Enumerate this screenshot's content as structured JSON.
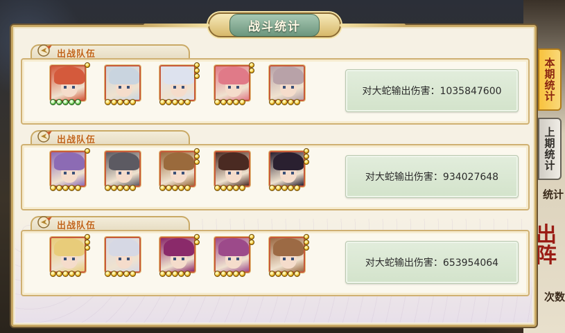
{
  "title": "战斗统计",
  "tabs": [
    {
      "label": "本期统计",
      "active": true
    },
    {
      "label": "上期统计",
      "active": false
    }
  ],
  "background_text": {
    "stats": "统计",
    "big_char": "出阵",
    "count": "次数"
  },
  "colors": {
    "accent_gold": "#c9a965",
    "label_orange": "#c0631a",
    "title_green": "#6c967d",
    "damage_box": "#d3e3cb",
    "tab_active": "#f8c23e"
  },
  "teams": [
    {
      "label": "出战队伍",
      "damage_label": "对大蛇输出伤害：1035847600",
      "heroes": [
        {
          "hair": "#d45a3c",
          "stars": 5,
          "star_color": "green",
          "awaken": 1
        },
        {
          "hair": "#c9d4df",
          "stars": 5,
          "star_color": "gold",
          "awaken": 0
        },
        {
          "hair": "#dde2ee",
          "stars": 5,
          "star_color": "gold",
          "awaken": 3
        },
        {
          "hair": "#e07a88",
          "stars": 5,
          "star_color": "gold",
          "awaken": 2
        },
        {
          "hair": "#b8a2a8",
          "stars": 5,
          "star_color": "gold",
          "awaken": 0
        }
      ]
    },
    {
      "label": "出战队伍",
      "damage_label": "对大蛇输出伤害：934027648",
      "heroes": [
        {
          "hair": "#8c6bb4",
          "stars": 5,
          "star_color": "gold",
          "awaken": 1
        },
        {
          "hair": "#5c5a62",
          "stars": 5,
          "star_color": "gold",
          "awaken": 0
        },
        {
          "hair": "#9a6a3c",
          "stars": 5,
          "star_color": "gold",
          "awaken": 3
        },
        {
          "hair": "#4a2a22",
          "stars": 5,
          "star_color": "gold",
          "awaken": 0
        },
        {
          "hair": "#2a2030",
          "stars": 5,
          "star_color": "gold",
          "awaken": 3
        }
      ]
    },
    {
      "label": "出战队伍",
      "damage_label": "对大蛇输出伤害：653954064",
      "heroes": [
        {
          "hair": "#e8cc7a",
          "stars": 5,
          "star_color": "gold",
          "awaken": 3
        },
        {
          "hair": "#d6d8e4",
          "stars": 5,
          "star_color": "gold",
          "awaken": 0
        },
        {
          "hair": "#8a2a6a",
          "stars": 5,
          "star_color": "gold",
          "awaken": 2
        },
        {
          "hair": "#9c4a8a",
          "stars": 5,
          "star_color": "gold",
          "awaken": 2
        },
        {
          "hair": "#9c6a44",
          "stars": 5,
          "star_color": "gold",
          "awaken": 3
        }
      ]
    }
  ]
}
